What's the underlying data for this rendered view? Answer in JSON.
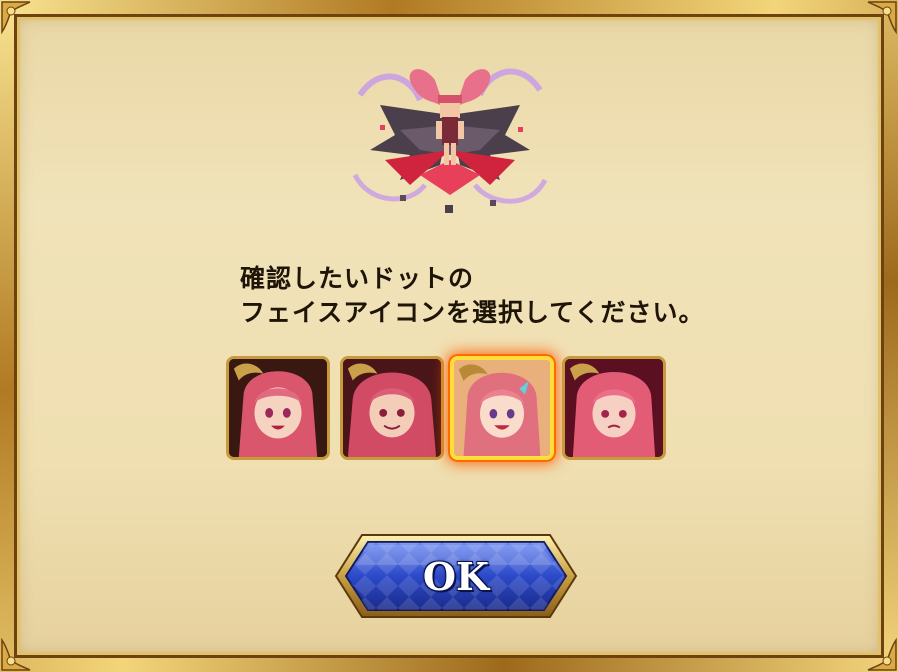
{
  "dialog": {
    "prompt_line1": "確認したいドットの",
    "prompt_line2": "フェイスアイコンを選択してください。"
  },
  "sprite": {
    "icon": "dot-sprite-preview"
  },
  "face_icons": [
    {
      "icon": "face-icon-1",
      "selected": false
    },
    {
      "icon": "face-icon-2",
      "selected": false
    },
    {
      "icon": "face-icon-3",
      "selected": true
    },
    {
      "icon": "face-icon-4",
      "selected": false
    }
  ],
  "ok_button": {
    "label": "OK"
  },
  "colors": {
    "panel": "#efdfb1",
    "frame_gold": "#c79a3b",
    "selection_glow": "#ff6a00",
    "button_blue": "#2c49c9",
    "text": "#1e1407"
  }
}
